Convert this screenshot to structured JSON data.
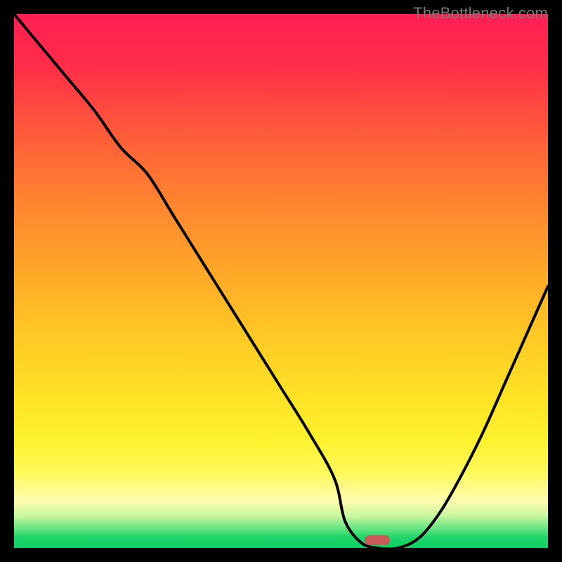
{
  "watermark": "TheBottleneck.com",
  "chart_data": {
    "type": "line",
    "title": "",
    "xlabel": "",
    "ylabel": "",
    "x_range": [
      0,
      100
    ],
    "y_range": [
      0,
      100
    ],
    "grid": false,
    "legend": false,
    "annotations": [
      "TheBottleneck.com"
    ],
    "background": "red-yellow-green vertical gradient (high=red/top, low=green/bottom)",
    "series": [
      {
        "name": "curve",
        "x": [
          0,
          5,
          10,
          15,
          20,
          25,
          30,
          35,
          40,
          45,
          50,
          55,
          60,
          62,
          65,
          68,
          72,
          76,
          80,
          84,
          88,
          92,
          96,
          100
        ],
        "y": [
          100,
          94,
          88,
          82,
          75,
          70,
          62,
          54,
          46,
          38,
          30,
          22,
          13,
          5,
          1,
          0,
          0,
          2,
          7,
          14,
          22,
          31,
          40,
          49
        ]
      }
    ],
    "marker": {
      "x": 68,
      "y": 1.5,
      "shape": "rounded-rect",
      "color": "#c95a5a"
    }
  },
  "colors": {
    "gradient_top": "#ff1f53",
    "gradient_mid": "#ffe326",
    "gradient_bottom": "#0cd162",
    "curve": "#000000",
    "marker": "#c95a5a",
    "frame": "#000000"
  }
}
